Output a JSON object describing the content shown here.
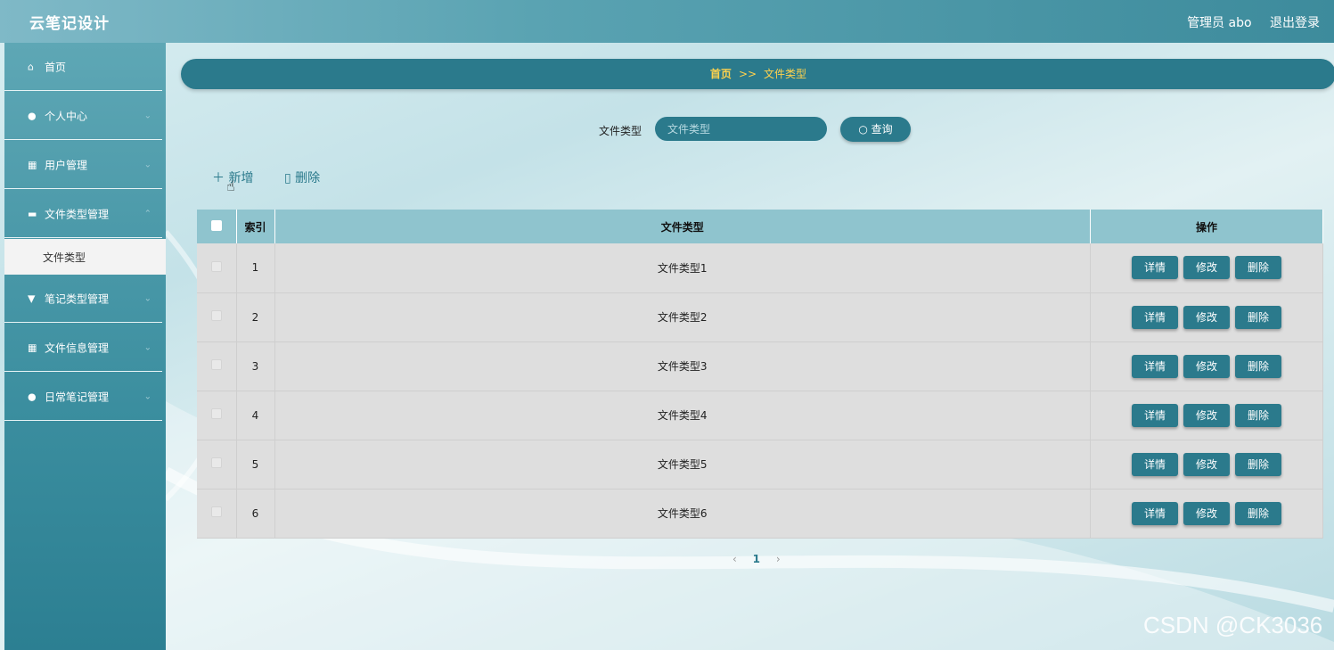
{
  "header": {
    "brand": "云笔记设计",
    "user_label": "管理员 abo",
    "logout_label": "退出登录"
  },
  "sidebar": {
    "items": [
      {
        "label": "首页",
        "icon": "home-icon",
        "glyph": "⌂"
      },
      {
        "label": "个人中心",
        "icon": "user-icon",
        "glyph": "●"
      },
      {
        "label": "用户管理",
        "icon": "grid-icon",
        "glyph": "▦"
      },
      {
        "label": "文件类型管理",
        "icon": "briefcase-icon",
        "glyph": "▬"
      },
      {
        "label": "笔记类型管理",
        "icon": "pin-icon",
        "glyph": "▼"
      },
      {
        "label": "文件信息管理",
        "icon": "grid-icon",
        "glyph": "▦"
      },
      {
        "label": "日常笔记管理",
        "icon": "user-icon",
        "glyph": "●"
      }
    ],
    "active_sub": "文件类型"
  },
  "breadcrumb": {
    "home": "首页",
    "sep": ">>",
    "current": "文件类型"
  },
  "search": {
    "label": "文件类型",
    "placeholder": "文件类型",
    "button": "查询"
  },
  "toolbar": {
    "add": "新增",
    "delete": "删除"
  },
  "table": {
    "headers": {
      "index": "索引",
      "type": "文件类型",
      "ops": "操作"
    },
    "rows": [
      {
        "index": "1",
        "type": "文件类型1"
      },
      {
        "index": "2",
        "type": "文件类型2"
      },
      {
        "index": "3",
        "type": "文件类型3"
      },
      {
        "index": "4",
        "type": "文件类型4"
      },
      {
        "index": "5",
        "type": "文件类型5"
      },
      {
        "index": "6",
        "type": "文件类型6"
      }
    ],
    "ops": {
      "detail": "详情",
      "edit": "修改",
      "delete": "删除"
    }
  },
  "pager": {
    "prev": "‹",
    "current": "1",
    "next": "›"
  },
  "watermark": "CSDN @CK3036",
  "colors": {
    "accent": "#2b7a8c",
    "breadcrumb_text": "#ffd24d"
  }
}
